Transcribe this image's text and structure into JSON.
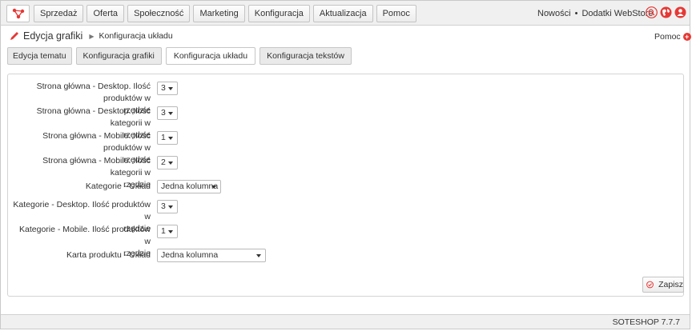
{
  "nav": {
    "items": [
      "Sprzedaż",
      "Oferta",
      "Społeczność",
      "Marketing",
      "Konfiguracja",
      "Aktualizacja",
      "Pomoc"
    ],
    "links": [
      "Nowości",
      "Dodatki WebStore"
    ],
    "separator": "•",
    "icons": [
      "search-icon",
      "globe-icon",
      "user-icon"
    ]
  },
  "breadcrumb": {
    "title": "Edycja grafiki",
    "arrow": "▶",
    "current": "Konfiguracja układu"
  },
  "help": {
    "label": "Pomoc",
    "icon": "+"
  },
  "tabs": [
    "Edycja tematu",
    "Konfiguracja grafiki",
    "Konfiguracja układu",
    "Konfiguracja tekstów"
  ],
  "active_tab": "Konfiguracja układu",
  "form": {
    "rows": [
      {
        "label_line1": "Strona główna - Desktop. Ilość produktów w",
        "label_line2": "rzędzie",
        "value": "3"
      },
      {
        "label_line1": "Strona główna - Desktop. Ilość kategorii w",
        "label_line2": "rzędzie",
        "value": "3"
      },
      {
        "label_line1": "Strona główna - Mobile. Ilość produktów w",
        "label_line2": "rzędzie",
        "value": "1"
      },
      {
        "label_line1": "Strona główna - Mobile. Ilość kategorii w",
        "label_line2": "rzędzie",
        "value": "2"
      },
      {
        "label_line1": "Kategorie - Układ",
        "label_line2": "",
        "value": "Jedna kolumna"
      },
      {
        "label_line1": "Kategorie - Desktop. Ilość produktów w",
        "label_line2": "rzędzie",
        "value": "3"
      },
      {
        "label_line1": "Kategorie - Mobile. Ilość produktów w",
        "label_line2": "rzędzie",
        "value": "1"
      },
      {
        "label_line1": "Karta produktu - Układ",
        "label_line2": "",
        "value": "Jedna kolumna"
      }
    ]
  },
  "save_label": "Zapisz",
  "version": "SOTESHOP 7.7.7",
  "colors": {
    "accent": "#e53935",
    "border": "#c4c4c4",
    "bar": "#f0f0f0"
  }
}
